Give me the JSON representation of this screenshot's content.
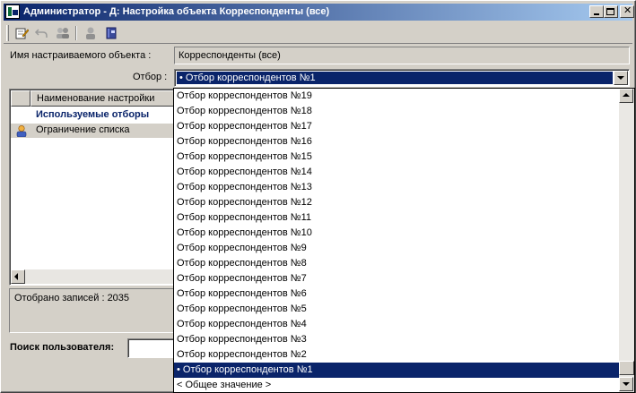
{
  "window": {
    "title": "Администратор - Д: Настройка объекта Корреспонденты (все)"
  },
  "toolbar": {
    "buttons": [
      {
        "icon": "edit-icon"
      },
      {
        "icon": "undo-icon"
      },
      {
        "icon": "users-icon"
      },
      {
        "icon": "user-icon"
      },
      {
        "icon": "book-icon"
      }
    ]
  },
  "form": {
    "object_label": "Имя настраиваемого объекта :",
    "object_value": "Корреспонденты (все)",
    "filter_label": "Отбор :",
    "filter_value": "• Отбор корреспондентов №1"
  },
  "grid": {
    "column_header": "Наименование настройки",
    "rows": [
      {
        "label": "Используемые отборы",
        "style": "bold"
      },
      {
        "label": "Ограничение списка",
        "style": "selected",
        "icon": "user-icon"
      }
    ]
  },
  "status": {
    "records": "Отобрано записей : 2035"
  },
  "search": {
    "label": "Поиск пользователя:",
    "value": ""
  },
  "dropdown": {
    "items": [
      "Отбор корреспондентов №19",
      "Отбор корреспондентов №18",
      "Отбор корреспондентов №17",
      "Отбор корреспондентов №16",
      "Отбор корреспондентов №15",
      "Отбор корреспондентов №14",
      "Отбор корреспондентов №13",
      "Отбор корреспондентов №12",
      "Отбор корреспондентов №11",
      "Отбор корреспондентов №10",
      "Отбор корреспондентов №9",
      "Отбор корреспондентов №8",
      "Отбор корреспондентов №7",
      "Отбор корреспондентов №6",
      "Отбор корреспондентов №5",
      "Отбор корреспондентов №4",
      "Отбор корреспондентов №3",
      "Отбор корреспондентов №2",
      "• Отбор корреспондентов №1",
      "< Общее значение >"
    ],
    "selected_index": 18
  },
  "colors": {
    "title_gradient_start": "#0a246a",
    "title_gradient_end": "#a6caf0",
    "selection": "#0a246a",
    "face": "#d4d0c8"
  }
}
